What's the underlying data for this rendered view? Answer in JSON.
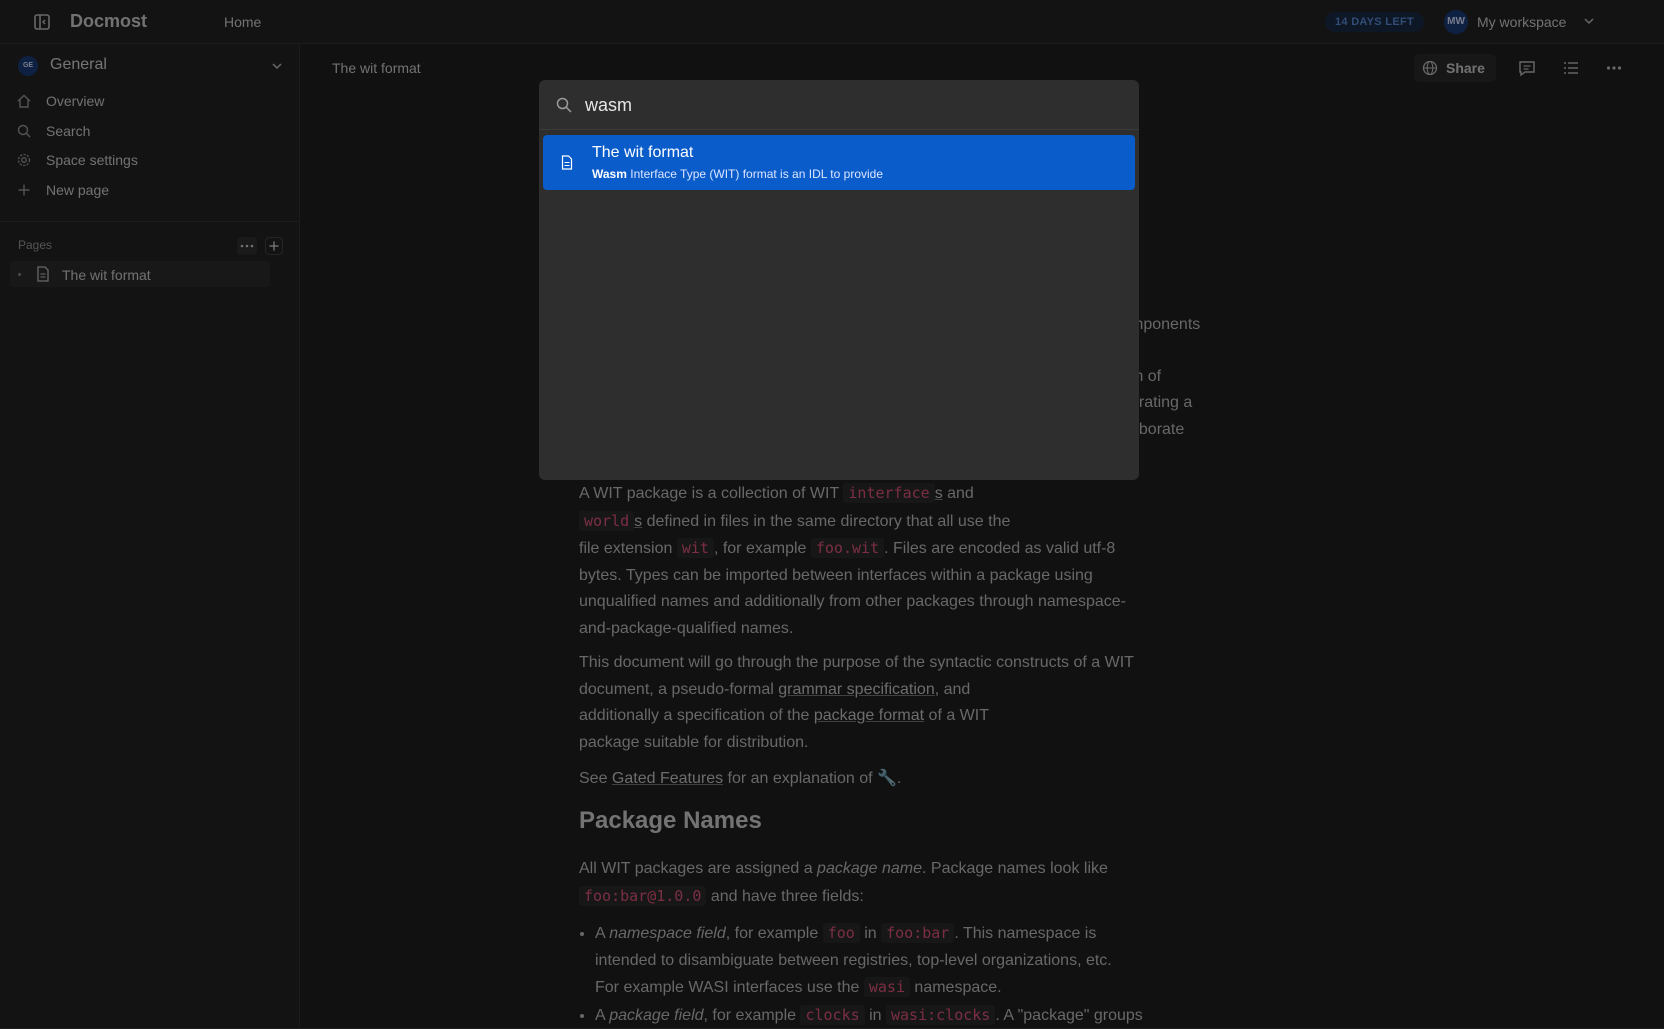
{
  "header": {
    "app_name": "Docmost",
    "home_label": "Home",
    "trial_badge": "14 DAYS LEFT",
    "workspace_avatar": "MW",
    "workspace_name": "My workspace"
  },
  "sidebar": {
    "space_avatar": "GE",
    "space_name": "General",
    "nav": [
      {
        "label": "Overview",
        "icon": "home-icon"
      },
      {
        "label": "Search",
        "icon": "search-icon"
      },
      {
        "label": "Space settings",
        "icon": "gear-icon"
      },
      {
        "label": "New page",
        "icon": "plus-icon"
      }
    ],
    "pages_label": "Pages",
    "pages": [
      {
        "label": "The wit format",
        "icon": "file-text-icon"
      }
    ]
  },
  "toolbar": {
    "breadcrumb": "The wit format",
    "share_label": "Share"
  },
  "document": {
    "frag_1": "mponents",
    "frag_2": "m of",
    "frag_3": "erating a",
    "frag_4": "aborate",
    "p1": {
      "t1": "A WIT package is a collection of WIT ",
      "c1": "interface",
      "t2": "s",
      "t3": " and",
      "c2": "world",
      "t4": "s",
      "t5": " defined in files in the same directory that all use the",
      "t6": "file extension ",
      "c3": "wit",
      "t7": ", for example ",
      "c4": "foo.wit",
      "t8": ". Files are encoded as valid utf-8",
      "t9": "bytes. Types can be imported between interfaces within a package using",
      "t10": "unqualified names and additionally from other packages through namespace-",
      "t11": "and-package-qualified names."
    },
    "p2": {
      "t1": "This document will go through the purpose of the syntactic constructs of a WIT",
      "t2": "document, a pseudo-formal ",
      "l1": "grammar specification",
      "t3": ", and",
      "t4": "additionally a specification of the ",
      "l2": "package format",
      "t5": " of a WIT",
      "t6": "package suitable for distribution."
    },
    "p3": {
      "t1": "See ",
      "l1": "Gated Features",
      "t2": " for an explanation of 🔧."
    },
    "h2": "Package Names",
    "p4": {
      "t1": "All WIT packages are assigned a ",
      "i1": "package name",
      "t2": ". Package names look like",
      "c1": "foo:bar@1.0.0",
      "t3": " and have three fields:"
    },
    "li1": {
      "t1": "A ",
      "i1": "namespace field",
      "t2": ", for example ",
      "c1": "foo",
      "t3": " in ",
      "c2": "foo:bar",
      "t4": ". This namespace is",
      "t5": "intended to disambiguate between registries, top-level organizations, etc.",
      "t6": "For example WASI interfaces use the ",
      "c3": "wasi",
      "t7": " namespace."
    },
    "li2": {
      "t1": "A ",
      "i1": "package field",
      "t2": ", for example ",
      "c1": "clocks",
      "t3": " in ",
      "c2": "wasi:clocks",
      "t4": ". A \"package\" groups"
    }
  },
  "search_modal": {
    "query": "wasm",
    "results": [
      {
        "title": "The wit format",
        "highlight": "Wasm",
        "snippet": " Interface Type (WIT) format is an IDL to provide",
        "icon": "file-text-icon"
      }
    ]
  },
  "colors": {
    "accent": "#0b5ccb",
    "code_text": "#e0557a",
    "background": "#1f1f1f"
  }
}
